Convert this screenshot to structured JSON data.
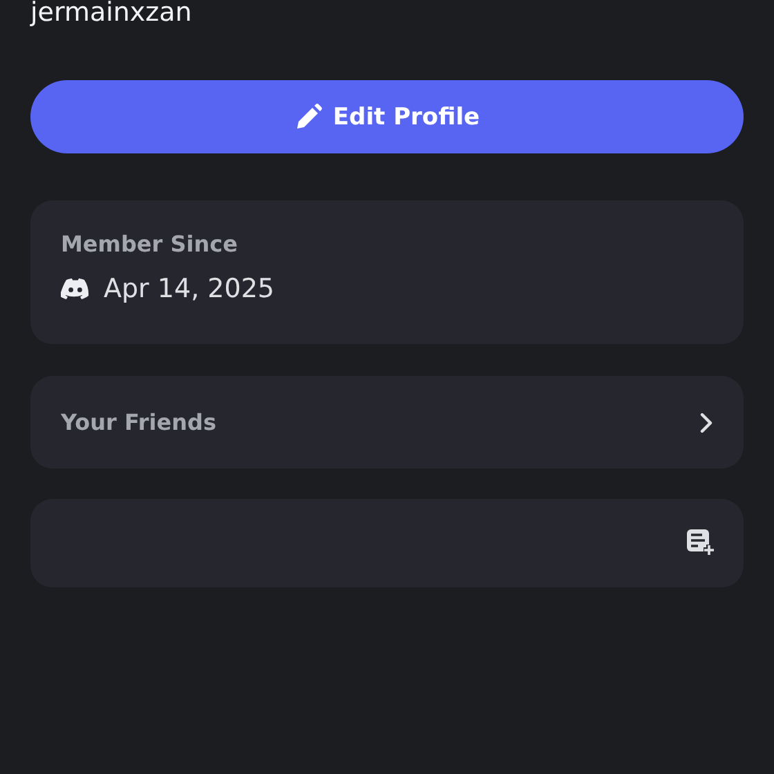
{
  "username": "jermainxzan",
  "edit_button": {
    "label": "Edit Profile"
  },
  "member_since": {
    "label": "Member Since",
    "date": "Apr 14, 2025"
  },
  "friends": {
    "label": "Your Friends"
  }
}
